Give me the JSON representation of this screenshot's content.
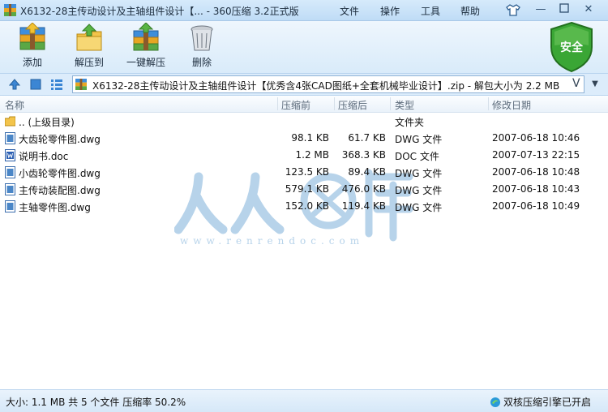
{
  "window": {
    "title": "X6132-28主传动设计及主轴组件设计【... - 360压缩 3.2正式版",
    "menu": [
      "文件",
      "操作",
      "工具",
      "帮助"
    ]
  },
  "toolbar": {
    "add_label": "添加",
    "extract_label": "解压到",
    "one_click_label": "一键解压",
    "delete_label": "删除",
    "security_label": "安全"
  },
  "address": {
    "path": "X6132-28主传动设计及主轴组件设计【优秀含4张CAD图纸+全套机械毕业设计】.zip - 解包大小为 2.2 MB",
    "dropdown_glyph": "V"
  },
  "columns": [
    "名称",
    "压缩前",
    "压缩后",
    "类型",
    "修改日期"
  ],
  "files": [
    {
      "name": ".. (上级目录)",
      "before": "",
      "after": "",
      "type": "文件夹",
      "date": ""
    },
    {
      "name": "大齿轮零件图.dwg",
      "before": "98.1 KB",
      "after": "61.7 KB",
      "type": "DWG 文件",
      "date": "2007-06-18 10:46"
    },
    {
      "name": "说明书.doc",
      "before": "1.2 MB",
      "after": "368.3 KB",
      "type": "DOC 文件",
      "date": "2007-07-13 22:15"
    },
    {
      "name": "小齿轮零件图.dwg",
      "before": "123.5 KB",
      "after": "89.4 KB",
      "type": "DWG 文件",
      "date": "2007-06-18 10:48"
    },
    {
      "name": "主传动装配图.dwg",
      "before": "579.1 KB",
      "after": "476.0 KB",
      "type": "DWG 文件",
      "date": "2007-06-18 10:43"
    },
    {
      "name": "主轴零件图.dwg",
      "before": "152.0 KB",
      "after": "119.4 KB",
      "type": "DWG 文件",
      "date": "2007-06-18 10:49"
    }
  ],
  "watermark": {
    "text": "人人文库",
    "url": "www.renrendoc.com"
  },
  "status": {
    "summary": "大小: 1.1 MB 共 5 个文件 压缩率 50.2%",
    "engine": "双核压缩引擎已开启"
  },
  "colors": {
    "titlebar": "#cfe5f9",
    "shield": "#3aa635",
    "watermark": "#b7d3ea"
  }
}
